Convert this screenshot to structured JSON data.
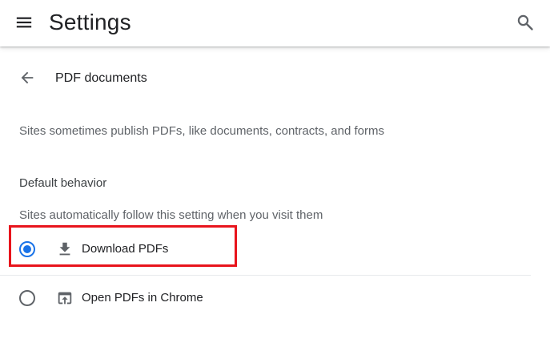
{
  "header": {
    "title": "Settings",
    "menu_icon": "hamburger-menu-icon",
    "search_icon": "search-icon"
  },
  "page": {
    "back_icon": "arrow-back-icon",
    "title": "PDF documents",
    "description": "Sites sometimes publish PDFs, like documents, contracts, and forms"
  },
  "section": {
    "heading": "Default behavior",
    "subheading": "Sites automatically follow this setting when you visit them",
    "options": [
      {
        "label": "Download PDFs",
        "icon": "download-icon",
        "selected": true
      },
      {
        "label": "Open PDFs in Chrome",
        "icon": "open-in-browser-icon",
        "selected": false
      }
    ]
  },
  "colors": {
    "accent": "#1a73e8",
    "highlight": "#e8141c",
    "text_primary": "#202124",
    "text_secondary": "#5f6368"
  }
}
